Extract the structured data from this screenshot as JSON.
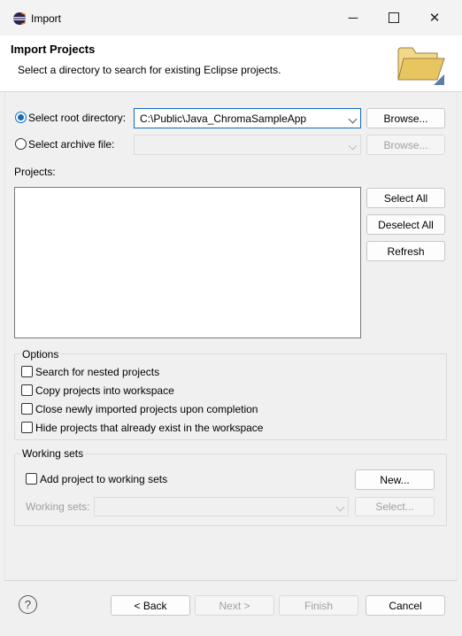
{
  "window": {
    "title": "Import",
    "minimize_glyph": "─",
    "maximize_glyph": "☐",
    "close_glyph": "✕"
  },
  "banner": {
    "title": "Import Projects",
    "description": "Select a directory to search for existing Eclipse projects."
  },
  "source": {
    "root_label": "Select root directory:",
    "root_value": "C:\\Public\\Java_ChromaSampleApp",
    "root_browse": "Browse...",
    "archive_label": "Select archive file:",
    "archive_value": "",
    "archive_browse": "Browse..."
  },
  "projects": {
    "label": "Projects:",
    "items": [],
    "select_all": "Select All",
    "deselect_all": "Deselect All",
    "refresh": "Refresh"
  },
  "options": {
    "legend": "Options",
    "items": [
      {
        "label": "Search for nested projects",
        "checked": false
      },
      {
        "label": "Copy projects into workspace",
        "checked": false
      },
      {
        "label": "Close newly imported projects upon completion",
        "checked": false
      },
      {
        "label": "Hide projects that already exist in the workspace",
        "checked": false
      }
    ]
  },
  "working_sets": {
    "legend": "Working sets",
    "add_label": "Add project to working sets",
    "new_button": "New...",
    "sets_label": "Working sets:",
    "sets_value": "",
    "select_button": "Select..."
  },
  "footer": {
    "help_glyph": "?",
    "back": "< Back",
    "next": "Next >",
    "finish": "Finish",
    "cancel": "Cancel"
  },
  "colors": {
    "accent": "#0f6cbd",
    "banner_bg": "#ffffff",
    "dialog_bg": "#f0f0f0"
  }
}
